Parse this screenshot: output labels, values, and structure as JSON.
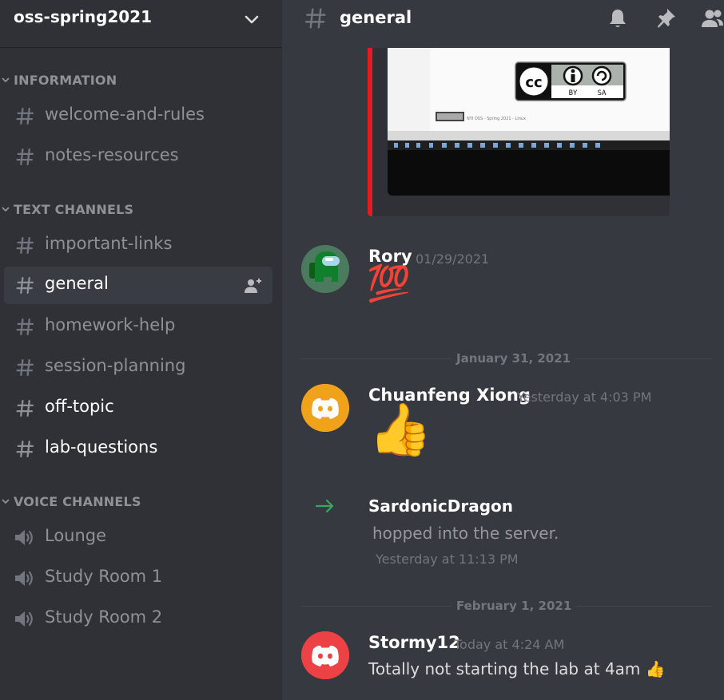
{
  "server": {
    "name": "oss-spring2021"
  },
  "categories": {
    "information": "INFORMATION",
    "text": "TEXT CHANNELS",
    "voice": "VOICE CHANNELS"
  },
  "channels": {
    "welcome": "welcome-and-rules",
    "notes": "notes-resources",
    "important": "important-links",
    "general": "general",
    "homework": "homework-help",
    "session": "session-planning",
    "offtopic": "off-topic",
    "lab": "lab-questions"
  },
  "voice": {
    "lounge": "Lounge",
    "study1": "Study Room 1",
    "study2": "Study Room 2"
  },
  "topbar": {
    "channel": "general"
  },
  "embed": {
    "cc_letters": "cc",
    "by": "BY",
    "sa": "SA",
    "footer_text": "NYI OSS - Spring 2021 - Linux"
  },
  "messages": [
    {
      "author": "Rory",
      "time": "01/29/2021",
      "emoji": "💯",
      "avatar_color": "#2d7d46"
    },
    {
      "author": "Chuanfeng Xiong",
      "time": "Yesterday at 4:03 PM",
      "emoji": "👍",
      "avatar_color": "#f0a21a"
    },
    {
      "author": "SardonicDragon",
      "text": "hopped into the server.",
      "time": "Yesterday at 11:13 PM"
    },
    {
      "author": "Stormy12",
      "time": "Today at 4:24 AM",
      "text": "Totally not starting the lab at 4am",
      "emoji": "👍",
      "avatar_color": "#ed4245"
    }
  ],
  "dividers": {
    "d1": "January 31, 2021",
    "d2": "February 1, 2021"
  },
  "colors": {
    "accent_red": "#e31b23",
    "join_arrow": "#3ba55d"
  }
}
